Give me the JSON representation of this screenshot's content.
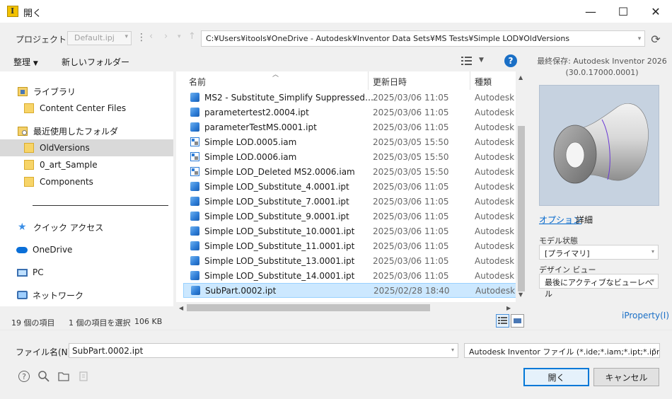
{
  "window": {
    "title": "開く",
    "min_glyph": "—",
    "max_glyph": "☐",
    "close_glyph": "✕"
  },
  "project": {
    "label": "プロジェクト(J):",
    "value": "Default.ipj"
  },
  "path": "C:¥Users¥itools¥OneDrive - Autodesk¥Inventor Data Sets¥MS Tests¥Simple LOD¥OldVersions",
  "toolbar": {
    "organize": "整理",
    "new_folder": "新しいフォルダー"
  },
  "preview_info": {
    "line1": "最終保存: Autodesk Inventor 2026",
    "line2": "(30.0.17000.0001)"
  },
  "nav": [
    {
      "label": "ライブラリ",
      "icon": "library-icon"
    },
    {
      "label": "Content Center Files",
      "icon": "folder-icon"
    },
    {
      "label": "最近使用したフォルダ",
      "icon": "recent-folders-icon"
    },
    {
      "label": "OldVersions",
      "icon": "folder-icon"
    },
    {
      "label": "0_art_Sample",
      "icon": "folder-icon"
    },
    {
      "label": "Components",
      "icon": "folder-icon"
    },
    {
      "label": "クイック アクセス",
      "icon": "star-icon"
    },
    {
      "label": "OneDrive",
      "icon": "cloud-icon"
    },
    {
      "label": "PC",
      "icon": "pc-icon"
    },
    {
      "label": "ネットワーク",
      "icon": "network-icon"
    }
  ],
  "columns": {
    "name": "名前",
    "date": "更新日時",
    "type": "種類"
  },
  "files": [
    {
      "name": "MS2 - Substitute_Simplify Suppressed DE...",
      "date": "2025/03/06 11:05",
      "type": "Autodesk In",
      "kind": "ipt"
    },
    {
      "name": "parametertest2.0004.ipt",
      "date": "2025/03/06 11:05",
      "type": "Autodesk In",
      "kind": "ipt"
    },
    {
      "name": "parameterTestMS.0001.ipt",
      "date": "2025/03/06 11:05",
      "type": "Autodesk In",
      "kind": "ipt"
    },
    {
      "name": "Simple LOD.0005.iam",
      "date": "2025/03/05 15:50",
      "type": "Autodesk In",
      "kind": "iam"
    },
    {
      "name": "Simple LOD.0006.iam",
      "date": "2025/03/05 15:50",
      "type": "Autodesk In",
      "kind": "iam"
    },
    {
      "name": "Simple LOD_Deleted MS2.0006.iam",
      "date": "2025/03/05 15:50",
      "type": "Autodesk In",
      "kind": "iam"
    },
    {
      "name": "Simple LOD_Substitute_4.0001.ipt",
      "date": "2025/03/06 11:05",
      "type": "Autodesk In",
      "kind": "ipt"
    },
    {
      "name": "Simple LOD_Substitute_7.0001.ipt",
      "date": "2025/03/06 11:05",
      "type": "Autodesk In",
      "kind": "ipt"
    },
    {
      "name": "Simple LOD_Substitute_9.0001.ipt",
      "date": "2025/03/06 11:05",
      "type": "Autodesk In",
      "kind": "ipt"
    },
    {
      "name": "Simple LOD_Substitute_10.0001.ipt",
      "date": "2025/03/06 11:05",
      "type": "Autodesk In",
      "kind": "ipt"
    },
    {
      "name": "Simple LOD_Substitute_11.0001.ipt",
      "date": "2025/03/06 11:05",
      "type": "Autodesk In",
      "kind": "ipt"
    },
    {
      "name": "Simple LOD_Substitute_13.0001.ipt",
      "date": "2025/03/06 11:05",
      "type": "Autodesk In",
      "kind": "ipt"
    },
    {
      "name": "Simple LOD_Substitute_14.0001.ipt",
      "date": "2025/03/06 11:05",
      "type": "Autodesk In",
      "kind": "ipt"
    },
    {
      "name": "SubPart.0002.ipt",
      "date": "2025/02/28 18:40",
      "type": "Autodesk In",
      "kind": "ipt",
      "selected": true
    }
  ],
  "side": {
    "options_link": "オプション",
    "details_label": "詳細",
    "model_state_label": "モデル状態",
    "model_state_value": "[プライマリ]",
    "design_view_label": "デザイン ビュー",
    "design_view_value": "最後にアクティブなビューレベル",
    "iproperty_link": "iProperty(I)"
  },
  "status": {
    "count": "19 個の項目",
    "selected": "1 個の項目を選択",
    "size": "106 KB"
  },
  "filename": {
    "label": "ファイル名(N):",
    "value": "SubPart.0002.ipt"
  },
  "filetype": "Autodesk Inventor ファイル (*.ide;*.iam;*.ipt;*.ipn;*.d...",
  "buttons": {
    "open": "開く",
    "cancel": "キャンセル"
  },
  "colors": {
    "accent": "#0078d7",
    "selection": "#cce8ff",
    "link": "#0066cc"
  }
}
